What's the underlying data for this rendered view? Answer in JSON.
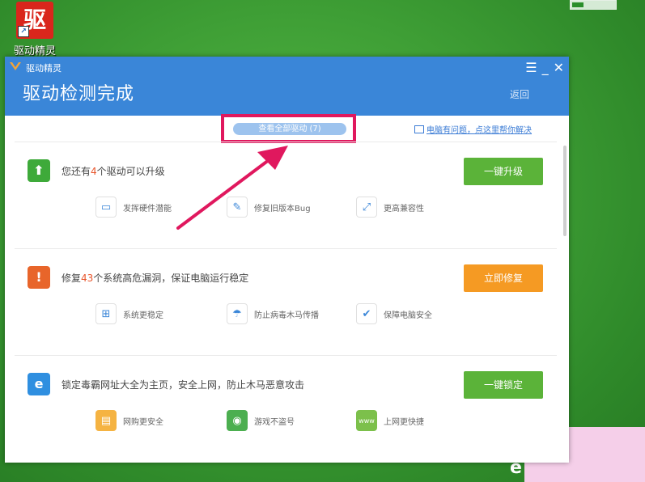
{
  "desktop": {
    "icon_glyph": "驱",
    "icon_label": "驱动精灵"
  },
  "window": {
    "app_name": "驱动精灵",
    "title": "驱动检测完成",
    "back_label": "返回",
    "controls": [
      "☰",
      "_",
      "✕"
    ]
  },
  "link_bar": {
    "view_all_label": "查看全部驱动 (7)",
    "help_link_label": "电脑有问题，点这里帮你解决"
  },
  "sections": [
    {
      "icon": "upgrade-arrow-icon",
      "prefix": "您还有",
      "number": "4",
      "suffix": "个驱动可以升级",
      "button_label": "一键升级",
      "button_color": "#5bb339",
      "features": [
        {
          "icon": "monitor-icon",
          "label": "发挥硬件潜能"
        },
        {
          "icon": "wrench-icon",
          "label": "修复旧版本Bug"
        },
        {
          "icon": "compat-icon",
          "label": "更高兼容性"
        }
      ]
    },
    {
      "icon": "shield-icon",
      "prefix": "修复",
      "number": "43",
      "suffix": "个系统高危漏洞，保证电脑运行稳定",
      "button_label": "立即修复",
      "button_color": "#f59a23",
      "features": [
        {
          "icon": "windows-icon",
          "label": "系统更稳定"
        },
        {
          "icon": "umbrella-icon",
          "label": "防止病毒木马传播"
        },
        {
          "icon": "shield-check-icon",
          "label": "保障电脑安全"
        }
      ]
    },
    {
      "icon": "browser-icon",
      "prefix": "",
      "number": "",
      "suffix": "锁定毒霸网址大全为主页，安全上网，防止木马恶意攻击",
      "button_label": "一键锁定",
      "button_color": "#5bb339",
      "features": [
        {
          "icon": "basket-icon",
          "label": "网购更安全"
        },
        {
          "icon": "gamepad-icon",
          "label": "游戏不盗号"
        },
        {
          "icon": "www-icon",
          "label": "上网更快捷"
        }
      ]
    }
  ],
  "colors": {
    "header_blue": "#3a86d8",
    "highlight_pink": "#e0185e",
    "accent_orange": "#e8542a"
  }
}
